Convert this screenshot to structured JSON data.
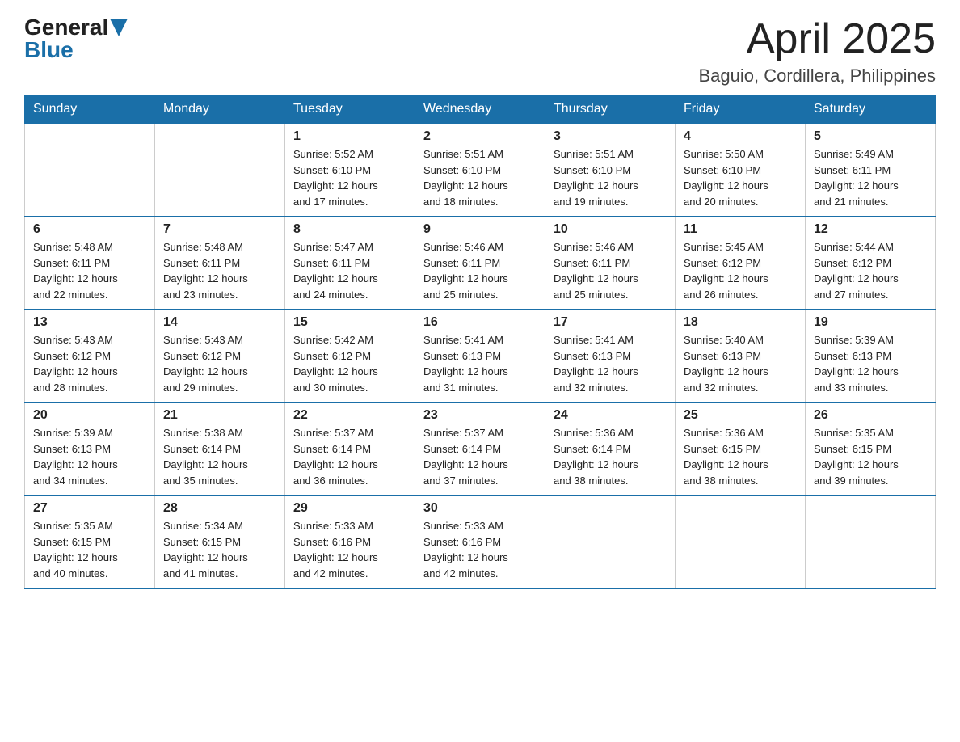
{
  "header": {
    "logo_general": "General",
    "logo_blue": "Blue",
    "month_title": "April 2025",
    "location": "Baguio, Cordillera, Philippines"
  },
  "days_of_week": [
    "Sunday",
    "Monday",
    "Tuesday",
    "Wednesday",
    "Thursday",
    "Friday",
    "Saturday"
  ],
  "weeks": [
    [
      {
        "day": "",
        "info": ""
      },
      {
        "day": "",
        "info": ""
      },
      {
        "day": "1",
        "info": "Sunrise: 5:52 AM\nSunset: 6:10 PM\nDaylight: 12 hours\nand 17 minutes."
      },
      {
        "day": "2",
        "info": "Sunrise: 5:51 AM\nSunset: 6:10 PM\nDaylight: 12 hours\nand 18 minutes."
      },
      {
        "day": "3",
        "info": "Sunrise: 5:51 AM\nSunset: 6:10 PM\nDaylight: 12 hours\nand 19 minutes."
      },
      {
        "day": "4",
        "info": "Sunrise: 5:50 AM\nSunset: 6:10 PM\nDaylight: 12 hours\nand 20 minutes."
      },
      {
        "day": "5",
        "info": "Sunrise: 5:49 AM\nSunset: 6:11 PM\nDaylight: 12 hours\nand 21 minutes."
      }
    ],
    [
      {
        "day": "6",
        "info": "Sunrise: 5:48 AM\nSunset: 6:11 PM\nDaylight: 12 hours\nand 22 minutes."
      },
      {
        "day": "7",
        "info": "Sunrise: 5:48 AM\nSunset: 6:11 PM\nDaylight: 12 hours\nand 23 minutes."
      },
      {
        "day": "8",
        "info": "Sunrise: 5:47 AM\nSunset: 6:11 PM\nDaylight: 12 hours\nand 24 minutes."
      },
      {
        "day": "9",
        "info": "Sunrise: 5:46 AM\nSunset: 6:11 PM\nDaylight: 12 hours\nand 25 minutes."
      },
      {
        "day": "10",
        "info": "Sunrise: 5:46 AM\nSunset: 6:11 PM\nDaylight: 12 hours\nand 25 minutes."
      },
      {
        "day": "11",
        "info": "Sunrise: 5:45 AM\nSunset: 6:12 PM\nDaylight: 12 hours\nand 26 minutes."
      },
      {
        "day": "12",
        "info": "Sunrise: 5:44 AM\nSunset: 6:12 PM\nDaylight: 12 hours\nand 27 minutes."
      }
    ],
    [
      {
        "day": "13",
        "info": "Sunrise: 5:43 AM\nSunset: 6:12 PM\nDaylight: 12 hours\nand 28 minutes."
      },
      {
        "day": "14",
        "info": "Sunrise: 5:43 AM\nSunset: 6:12 PM\nDaylight: 12 hours\nand 29 minutes."
      },
      {
        "day": "15",
        "info": "Sunrise: 5:42 AM\nSunset: 6:12 PM\nDaylight: 12 hours\nand 30 minutes."
      },
      {
        "day": "16",
        "info": "Sunrise: 5:41 AM\nSunset: 6:13 PM\nDaylight: 12 hours\nand 31 minutes."
      },
      {
        "day": "17",
        "info": "Sunrise: 5:41 AM\nSunset: 6:13 PM\nDaylight: 12 hours\nand 32 minutes."
      },
      {
        "day": "18",
        "info": "Sunrise: 5:40 AM\nSunset: 6:13 PM\nDaylight: 12 hours\nand 32 minutes."
      },
      {
        "day": "19",
        "info": "Sunrise: 5:39 AM\nSunset: 6:13 PM\nDaylight: 12 hours\nand 33 minutes."
      }
    ],
    [
      {
        "day": "20",
        "info": "Sunrise: 5:39 AM\nSunset: 6:13 PM\nDaylight: 12 hours\nand 34 minutes."
      },
      {
        "day": "21",
        "info": "Sunrise: 5:38 AM\nSunset: 6:14 PM\nDaylight: 12 hours\nand 35 minutes."
      },
      {
        "day": "22",
        "info": "Sunrise: 5:37 AM\nSunset: 6:14 PM\nDaylight: 12 hours\nand 36 minutes."
      },
      {
        "day": "23",
        "info": "Sunrise: 5:37 AM\nSunset: 6:14 PM\nDaylight: 12 hours\nand 37 minutes."
      },
      {
        "day": "24",
        "info": "Sunrise: 5:36 AM\nSunset: 6:14 PM\nDaylight: 12 hours\nand 38 minutes."
      },
      {
        "day": "25",
        "info": "Sunrise: 5:36 AM\nSunset: 6:15 PM\nDaylight: 12 hours\nand 38 minutes."
      },
      {
        "day": "26",
        "info": "Sunrise: 5:35 AM\nSunset: 6:15 PM\nDaylight: 12 hours\nand 39 minutes."
      }
    ],
    [
      {
        "day": "27",
        "info": "Sunrise: 5:35 AM\nSunset: 6:15 PM\nDaylight: 12 hours\nand 40 minutes."
      },
      {
        "day": "28",
        "info": "Sunrise: 5:34 AM\nSunset: 6:15 PM\nDaylight: 12 hours\nand 41 minutes."
      },
      {
        "day": "29",
        "info": "Sunrise: 5:33 AM\nSunset: 6:16 PM\nDaylight: 12 hours\nand 42 minutes."
      },
      {
        "day": "30",
        "info": "Sunrise: 5:33 AM\nSunset: 6:16 PM\nDaylight: 12 hours\nand 42 minutes."
      },
      {
        "day": "",
        "info": ""
      },
      {
        "day": "",
        "info": ""
      },
      {
        "day": "",
        "info": ""
      }
    ]
  ]
}
